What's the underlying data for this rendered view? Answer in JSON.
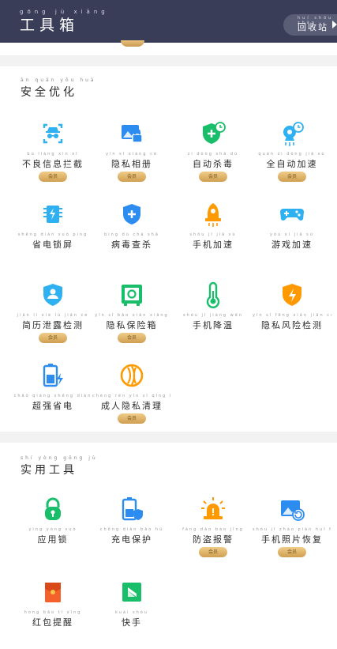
{
  "header": {
    "title_pinyin": "gōng jù xiāng",
    "title": "工具箱",
    "recycle_pinyin": "huí shōu zhàn",
    "recycle_label": "回收站"
  },
  "badge_text": "会员",
  "sections": {
    "security": {
      "title_pinyin": "ān quán yōu huà",
      "title": "安全优化",
      "items": [
        {
          "pinyin": "bù liáng xìn xī",
          "label": "不良信息拦截",
          "badge": true,
          "icon": "spy-icon",
          "color": "#2fb0f0"
        },
        {
          "pinyin": "yǐn sī xiàng cè",
          "label": "隐私相册",
          "badge": true,
          "icon": "photo-lock-icon",
          "color": "#2d8cf0"
        },
        {
          "pinyin": "zì dòng shā dú",
          "label": "自动杀毒",
          "badge": true,
          "icon": "shield-clock-icon",
          "color": "#19be6b"
        },
        {
          "pinyin": "quán zì dòng jiā sù",
          "label": "全自动加速",
          "badge": true,
          "icon": "rocket-clock-icon",
          "color": "#2fb0f0"
        },
        {
          "pinyin": "shěng diàn suǒ píng",
          "label": "省电锁屏",
          "badge": false,
          "icon": "battery-chip-icon",
          "color": "#2fb0f0"
        },
        {
          "pinyin": "bìng dú chá shā",
          "label": "病毒查杀",
          "badge": false,
          "icon": "shield-plus-icon",
          "color": "#2d8cf0"
        },
        {
          "pinyin": "shǒu jī jiā sù",
          "label": "手机加速",
          "badge": false,
          "icon": "rocket-icon",
          "color": "#ff9900"
        },
        {
          "pinyin": "yóu xì jiā sù",
          "label": "游戏加速",
          "badge": false,
          "icon": "gamepad-icon",
          "color": "#2fb0f0"
        },
        {
          "pinyin": "jiǎn lì xiè lù jiǎn cè",
          "label": "简历泄露检测",
          "badge": true,
          "icon": "shield-user-icon",
          "color": "#2fb0f0"
        },
        {
          "pinyin": "yǐn sī bǎo xiǎn xiāng",
          "label": "隐私保险箱",
          "badge": true,
          "icon": "safe-icon",
          "color": "#19be6b"
        },
        {
          "pinyin": "shǒu jī jiàng wēn",
          "label": "手机降温",
          "badge": false,
          "icon": "thermometer-icon",
          "color": "#19be6b"
        },
        {
          "pinyin": "yǐn sī fēng xiǎn jiǎn cè",
          "label": "隐私风险检测",
          "badge": false,
          "icon": "shield-bolt-icon",
          "color": "#ff9900"
        },
        {
          "pinyin": "chāo qiáng shěng diàn",
          "label": "超强省电",
          "badge": false,
          "icon": "battery-bolt-icon",
          "color": "#2d8cf0"
        },
        {
          "pinyin": "chéng rén yǐn sī qīng lǐ",
          "label": "成人隐私清理",
          "badge": true,
          "icon": "lens-icon",
          "color": "#ff9900"
        }
      ]
    },
    "tools": {
      "title_pinyin": "shí yòng gōng jù",
      "title": "实用工具",
      "items": [
        {
          "pinyin": "yìng yòng suǒ",
          "label": "应用锁",
          "badge": false,
          "icon": "lock-icon",
          "color": "#19be6b"
        },
        {
          "pinyin": "chōng diàn bǎo hù",
          "label": "充电保护",
          "badge": false,
          "icon": "battery-shield-icon",
          "color": "#2d8cf0"
        },
        {
          "pinyin": "fáng dào bào jǐng",
          "label": "防盗报警",
          "badge": true,
          "icon": "alarm-icon",
          "color": "#ff9900"
        },
        {
          "pinyin": "shǒu jī zhào piàn huī fù",
          "label": "手机照片恢复",
          "badge": true,
          "icon": "photo-restore-icon",
          "color": "#2d8cf0"
        },
        {
          "pinyin": "hóng bāo tí xǐng",
          "label": "红包提醒",
          "badge": false,
          "icon": "red-packet-icon",
          "color": "#f5612a"
        },
        {
          "pinyin": "kuài shǒu",
          "label": "快手",
          "badge": false,
          "icon": "kuaishou-icon",
          "color": "#19be6b"
        }
      ]
    }
  }
}
